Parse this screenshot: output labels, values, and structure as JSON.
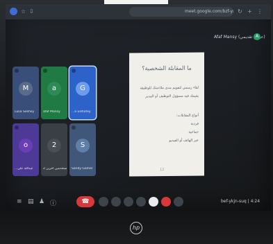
{
  "browser": {
    "url": "meet.google.com/bzf-ykje-suq"
  },
  "presentation": {
    "presenter_label": "Afaf Mansy (عرض تقديمي)",
    "presenter_initial": "A",
    "slide_title": "ما المقابلة الشخصية؟",
    "bullets": [
      "لقاء رسمي لتقويم مدى ملاءمتك للوظيفة",
      "يقيمك فيه مسؤول التوظيف أو المدير",
      "أنواع المقابلات:",
      "فردية",
      "جماعية",
      "عبر الهاتف أو الفيديو"
    ],
    "slide_page": "12"
  },
  "participants": [
    {
      "name": "Lulia Seshey",
      "initial": "M",
      "color": "#5b6b8c"
    },
    {
      "name": "afaf Mansy",
      "initial": "a",
      "color": "#2e8b57"
    },
    {
      "name": "...a Elshafey",
      "initial": "G",
      "color": "#2f6fd8"
    },
    {
      "name": "...عبدالله علي",
      "initial": "o",
      "color": "#6a3fb5"
    },
    {
      "name": "2 مستخدمين آخرين",
      "initial": "2",
      "color": "#4a4f57"
    },
    {
      "name": "Sandy Gamal",
      "initial": "S",
      "color": "#5f7fa8"
    }
  ],
  "meeting": {
    "time": "4:24",
    "code": "bef-ykjn-suq"
  },
  "laptop": {
    "logo": "hp"
  }
}
